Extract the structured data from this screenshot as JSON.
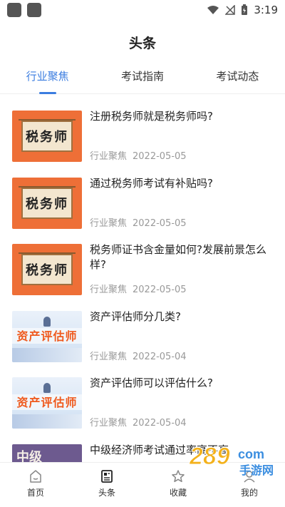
{
  "status_bar": {
    "time": "3:19",
    "icons": [
      "wifi-icon",
      "no-signal-icon",
      "battery-icon"
    ]
  },
  "header": {
    "title": "头条"
  },
  "tabs": [
    {
      "label": "行业聚焦",
      "active": true
    },
    {
      "label": "考试指南",
      "active": false
    },
    {
      "label": "考试动态",
      "active": false
    }
  ],
  "articles": [
    {
      "title": "注册税务师就是税务师吗?",
      "category": "行业聚焦",
      "date": "2022-05-05",
      "thumb_text": "税务师"
    },
    {
      "title": "通过税务师考试有补贴吗?",
      "category": "行业聚焦",
      "date": "2022-05-05",
      "thumb_text": "税务师"
    },
    {
      "title": "税务师证书含金量如何?发展前景怎么样?",
      "category": "行业聚焦",
      "date": "2022-05-05",
      "thumb_text": "税务师"
    },
    {
      "title": "资产评估师分几类?",
      "category": "行业聚焦",
      "date": "2022-05-04",
      "thumb_text": "资产评估师"
    },
    {
      "title": "资产评估师可以评估什么?",
      "category": "行业聚焦",
      "date": "2022-05-04",
      "thumb_text": "资产评估师"
    },
    {
      "title": "中级经济师考试通过率高不高",
      "thumb_text": "中级"
    }
  ],
  "tabbar": [
    {
      "label": "首页",
      "icon": "home-icon",
      "active": false
    },
    {
      "label": "头条",
      "icon": "headlines-icon",
      "active": true
    },
    {
      "label": "收藏",
      "icon": "star-icon",
      "active": false
    },
    {
      "label": "我的",
      "icon": "user-icon",
      "active": false
    }
  ],
  "watermark": {
    "text": "289",
    "subtext": "手游网",
    "suffix": "com"
  },
  "colors": {
    "accent": "#3b7de0",
    "meta": "#999999",
    "tax_thumb": "#ee6f37",
    "asset_text": "#ef5a1e"
  }
}
